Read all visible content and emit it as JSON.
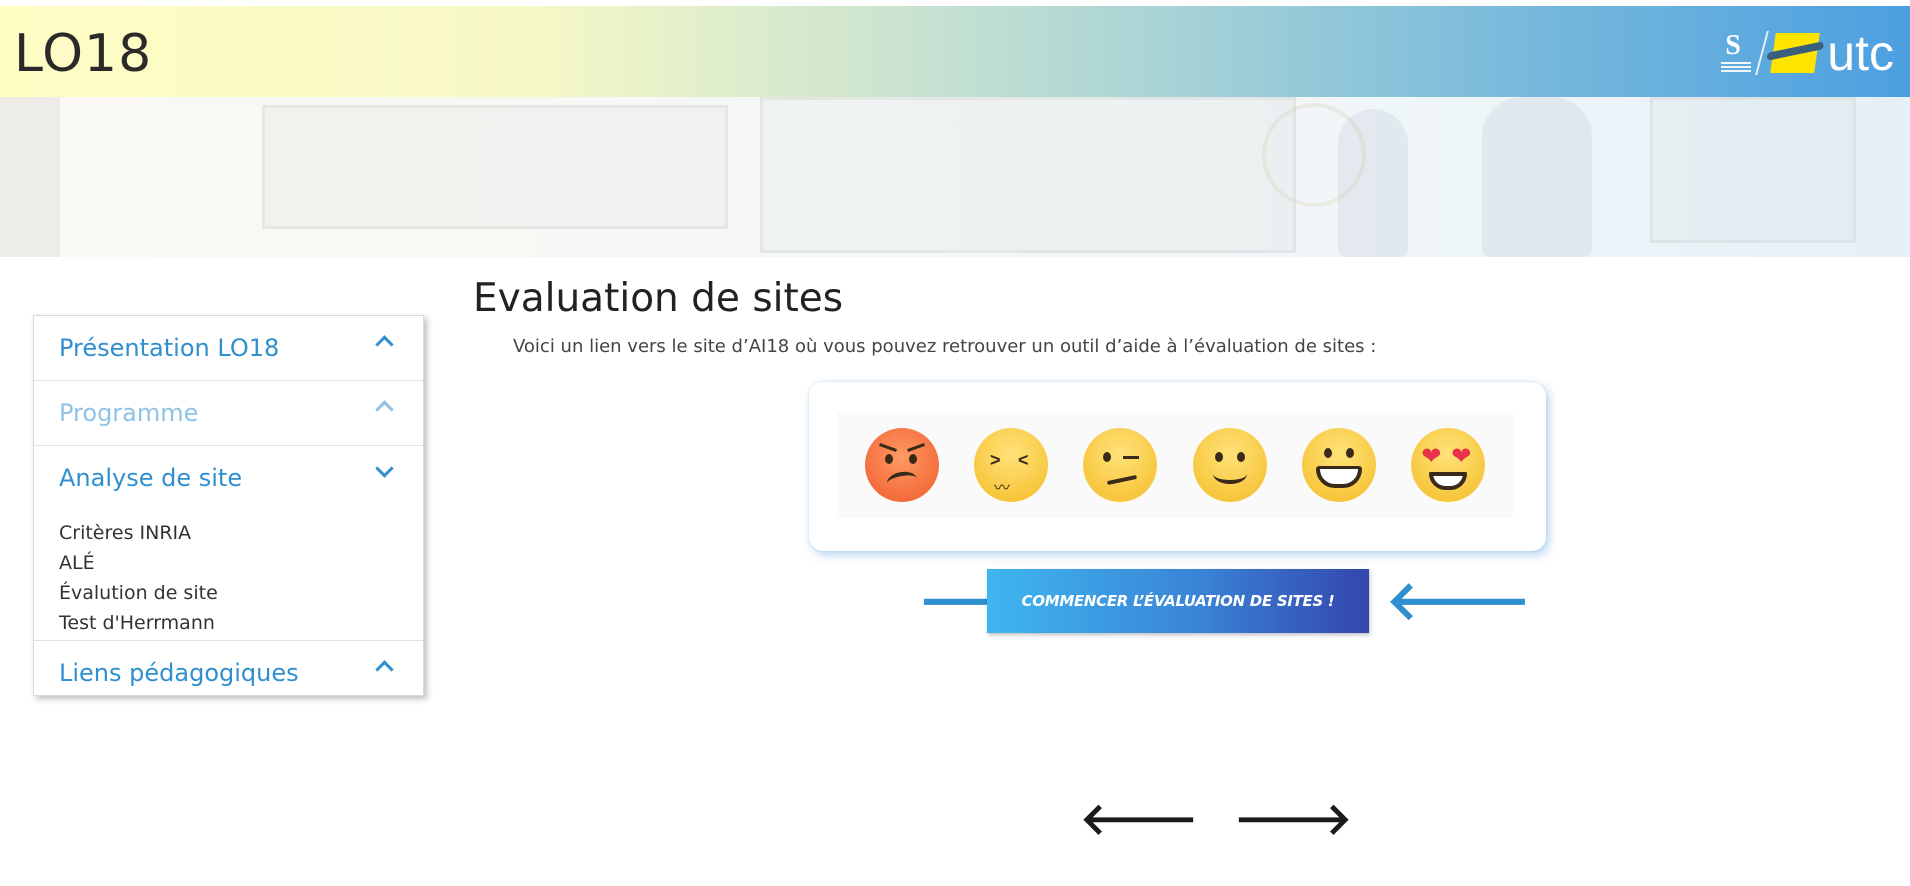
{
  "header": {
    "title": "LO18",
    "logo_text": "utc",
    "alliance_mark": "S"
  },
  "sidebar": {
    "sections": [
      {
        "label": "Présentation LO18",
        "state": "collapsed"
      },
      {
        "label": "Programme",
        "state": "collapsed"
      },
      {
        "label": "Analyse de site",
        "state": "expanded",
        "items": [
          "Critères INRIA",
          "ALÉ",
          "Évalution de site",
          "Test d'Herrmann"
        ]
      },
      {
        "label": "Liens pédagogiques",
        "state": "collapsed"
      }
    ]
  },
  "main": {
    "title": "Evaluation de sites",
    "intro": "Voici un lien vers le site d’AI18 où vous pouvez retrouver un outil d’aide à l’évaluation de sites :",
    "emojis": [
      "angry-face-icon",
      "confounded-face-icon",
      "confused-face-icon",
      "slight-smile-icon",
      "grinning-face-icon",
      "heart-eyes-icon"
    ],
    "cta_label": "COMMENCER L’ÉVALUATION DE SITES !",
    "arrow_right": "🡒",
    "arrow_left": "🡐"
  },
  "pager": {
    "prev": "🡐",
    "next": "🡒"
  },
  "colors": {
    "accent": "#2f8fcf",
    "accent_muted": "#8ec3e6",
    "cta_start": "#3fb6f0",
    "cta_end": "#3446ad"
  }
}
